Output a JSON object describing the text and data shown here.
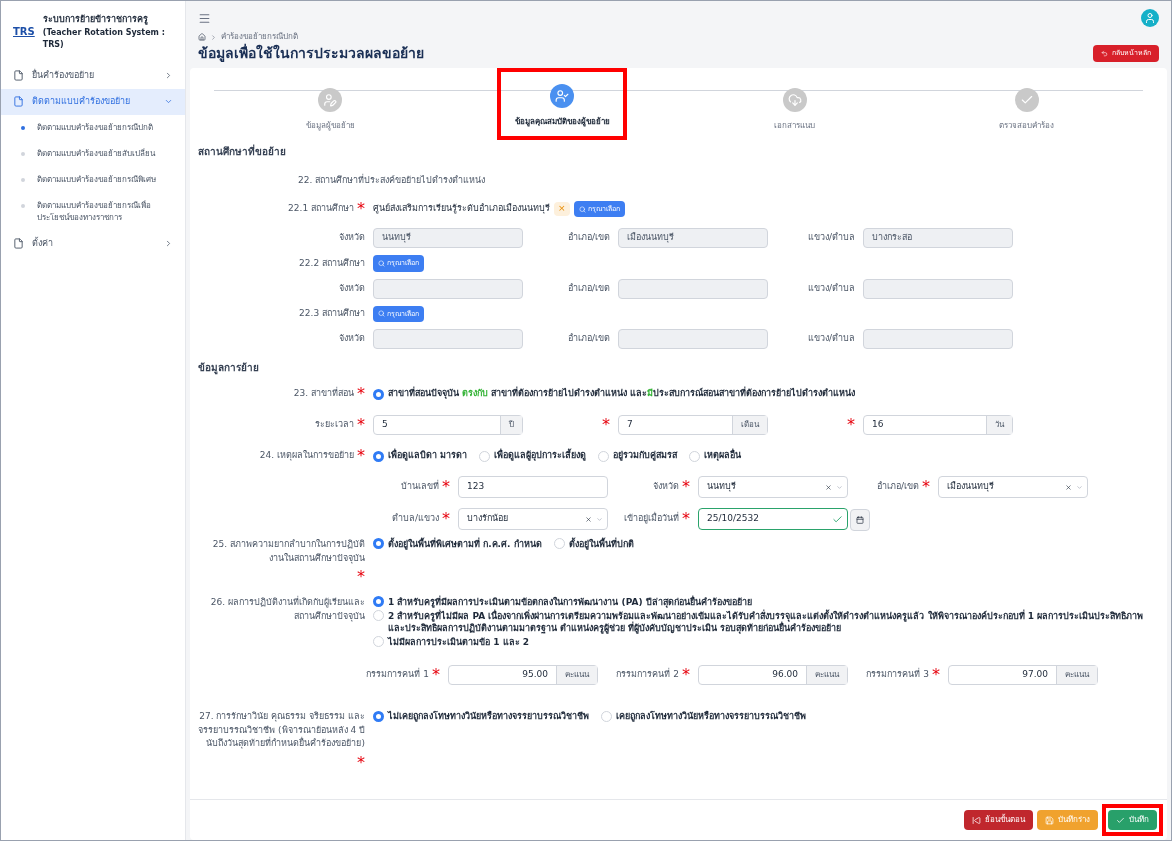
{
  "sidebar": {
    "logo": "TRS",
    "title": "ระบบการย้ายข้าราชการครู",
    "subtitle": "(Teacher Rotation System : TRS)",
    "items": [
      {
        "label": "ยื่นคำร้องขอย้าย",
        "expanded": false,
        "selected": false
      },
      {
        "label": "ติดตามแบบคำร้องขอย้าย",
        "expanded": true,
        "selected": true,
        "children": [
          {
            "label": "ติดตามแบบคำร้องขอย้ายกรณีปกติ",
            "selected": true
          },
          {
            "label": "ติดตามแบบคำร้องขอย้ายสับเปลี่ยน",
            "selected": false
          },
          {
            "label": "ติดตามแบบคำร้องขอย้ายกรณีพิเศษ",
            "selected": false
          },
          {
            "label": "ติดตามแบบคำร้องขอย้ายกรณีเพื่อประโยชน์ของทางราชการ",
            "selected": false
          }
        ]
      },
      {
        "label": "ตั้งค่า",
        "expanded": false,
        "selected": false
      }
    ]
  },
  "breadcrumb": "คำร้องขอย้ายกรณีปกติ",
  "page_title": "ข้อมูลเพื่อใช้ในการประมวลผลขอย้าย",
  "back_home": "กลับหน้าหลัก",
  "steps": [
    {
      "label": "ข้อมูลผู้ขอย้าย",
      "kind": "edit",
      "selected": false,
      "highlighted": false
    },
    {
      "label": "ข้อมูลคุณสมบัติของผู้ขอย้าย",
      "kind": "user-check",
      "selected": true,
      "highlighted": true
    },
    {
      "label": "เอกสารแนบ",
      "kind": "upload",
      "selected": false,
      "highlighted": false
    },
    {
      "label": "ตรวจสอบคำร้อง",
      "kind": "check",
      "selected": false,
      "highlighted": false
    }
  ],
  "school_section": {
    "title": "สถานศึกษาที่ขอย้าย",
    "question": "22. สถานศึกษาที่ประสงค์ขอย้ายไปดำรงตำแหน่ง",
    "schools": [
      {
        "label": "22.1 สถานศึกษา",
        "req": "*",
        "value": "ศูนย์ส่งเสริมการเรียนรู้ระดับอำเภอเมืองนนทบุรี",
        "clear": "×",
        "button": "กรุณาเลือก",
        "fields": [
          {
            "label": "จังหวัด",
            "value": "นนทบุรี"
          },
          {
            "label": "อำเภอ/เขต",
            "value": "เมืองนนทบุรี"
          },
          {
            "label": "แขวง/ตำบล",
            "value": "บางกระสอ"
          }
        ]
      },
      {
        "label": "22.2 สถานศึกษา",
        "button": "กรุณาเลือก",
        "fields": [
          {
            "label": "จังหวัด"
          },
          {
            "label": "อำเภอ/เขต"
          },
          {
            "label": "แขวง/ตำบล"
          }
        ]
      },
      {
        "label": "22.3 สถานศึกษา",
        "button": "กรุณาเลือก",
        "fields": [
          {
            "label": "จังหวัด"
          },
          {
            "label": "อำเภอ/เขต"
          },
          {
            "label": "แขวง/ตำบล"
          }
        ]
      }
    ]
  },
  "move_section": {
    "title": "ข้อมูลการย้าย",
    "q23": {
      "label": "23. สาขาที่สอน",
      "req": "*",
      "options": [
        {
          "selected": true,
          "segments": [
            {
              "text": "สาขาที่สอนปัจจุบัน ",
              "highlight": false
            },
            {
              "text": "ตรงกับ",
              "highlight": true
            },
            {
              "text": " สาขาที่ต้องการย้ายไปดำรงตำแหน่ง และ",
              "highlight": false
            },
            {
              "text": "มี",
              "highlight": true
            },
            {
              "text": "ประสบการณ์สอนสาขาที่ต้องการย้ายไปดำรงตำแหน่ง",
              "highlight": false
            }
          ]
        }
      ]
    },
    "duration": {
      "label": "ระยะเวลา",
      "req": "*",
      "parts": [
        {
          "value": "5",
          "unit": "ปี"
        },
        {
          "req": "*",
          "value": "7",
          "unit": "เดือน"
        },
        {
          "req": "*",
          "value": "16",
          "unit": "วัน"
        }
      ]
    },
    "q24": {
      "label": "24. เหตุผลในการขอย้าย",
      "req": "*",
      "options": [
        {
          "label": "เพื่อดูแลบิดา มารดา",
          "selected": true
        },
        {
          "label": "เพื่อดูแลผู้อุปการะเลี้ยงดู",
          "selected": false
        },
        {
          "label": "อยู่รวมกับคู่สมรส",
          "selected": false
        },
        {
          "label": "เหตุผลอื่น",
          "selected": false
        }
      ],
      "address": [
        {
          "label": "บ้านเลขที่",
          "req": "*",
          "value": "123",
          "kind": "text"
        },
        {
          "label": "จังหวัด",
          "req": "*",
          "value": "นนทบุรี",
          "kind": "select"
        },
        {
          "label": "อำเภอ/เขต",
          "req": "*",
          "value": "เมืองนนทบุรี",
          "kind": "select"
        },
        {
          "label": "ตำบล/แขวง",
          "req": "*",
          "value": "บางรักน้อย",
          "kind": "select"
        },
        {
          "label": "เข้าอยู่เมื่อวันที่",
          "req": "*",
          "value": "25/10/2532",
          "kind": "date"
        }
      ]
    },
    "q25": {
      "label": "25. สภาพความยากลำบากในการปฏิบัติงานในสถานศึกษาปัจจุบัน",
      "req": "*",
      "options": [
        {
          "label": "ตั้งอยู่ในพื้นที่พิเศษตามที่ ก.ค.ศ. กำหนด",
          "selected": true
        },
        {
          "label": "ตั้งอยู่ในพื้นที่ปกติ",
          "selected": false
        }
      ]
    },
    "q26": {
      "label": "26. ผลการปฏิบัติงานที่เกิดกับผู้เรียนและสถานศึกษาปัจจุบัน",
      "options": [
        {
          "label": "1 สำหรับครูที่มีผลการประเมินตามข้อตกลงในการพัฒนางาน (PA) ปีล่าสุดก่อนยื่นคำร้องขอย้าย",
          "selected": true
        },
        {
          "label": "2 สำหรับครูที่ไม่มีผล PA เนื่องจากเพิ่งผ่านการเตรียมความพร้อมและพัฒนาอย่างเข้มและได้รับคำสั่งบรรจุและแต่งตั้งให้ดำรงตำแหน่งครูแล้ว ให้พิจารณาองค์ประกอบที่ 1 ผลการประเมินประสิทธิภาพและประสิทธิผลการปฏิบัติงานตามมาตรฐาน ตำแหน่งครูผู้ช่วย ที่ผู้บังคับบัญชาประเมิน รอบสุดท้ายก่อนยื่นคำร้องขอย้าย",
          "selected": false
        },
        {
          "label": "ไม่มีผลการประเมินตามข้อ 1 และ 2",
          "selected": false
        }
      ],
      "scores": [
        {
          "label": "กรรมการคนที่ 1",
          "req": "*",
          "value": "95.00",
          "unit": "คะแนน"
        },
        {
          "label": "กรรมการคนที่ 2",
          "req": "*",
          "value": "96.00",
          "unit": "คะแนน"
        },
        {
          "label": "กรรมการคนที่ 3",
          "req": "*",
          "value": "97.00",
          "unit": "คะแนน"
        }
      ]
    },
    "q27": {
      "label": "27. การรักษาวินัย คุณธรรม จริยธรรม และจรรยาบรรณวิชาชีพ (พิจารณาย้อนหลัง 4 ปีนับถึงวันสุดท้ายที่กำหนดยื่นคำร้องขอย้าย)",
      "req": "*",
      "options": [
        {
          "label": "ไม่เคยถูกลงโทษทางวินัยหรือทางจรรยาบรรณวิชาชีพ",
          "selected": true
        },
        {
          "label": "เคยถูกลงโทษทางวินัยหรือทางจรรยาบรรณวิชาชีพ",
          "selected": false
        }
      ]
    }
  },
  "footer_buttons": [
    {
      "label": "ย้อนขั้นตอน",
      "kind": "back",
      "highlighted": false
    },
    {
      "label": "บันทึกร่าง",
      "kind": "draft",
      "highlighted": false
    },
    {
      "label": "บันทึก",
      "kind": "save",
      "highlighted": true
    }
  ]
}
